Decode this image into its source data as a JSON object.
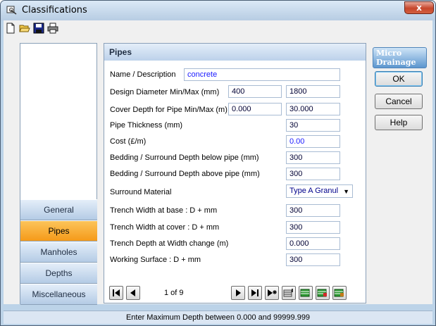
{
  "window": {
    "title": "Classifications",
    "close_label": "x"
  },
  "toolbar": {
    "icons": [
      "new-file-icon",
      "open-folder-icon",
      "save-icon",
      "print-icon"
    ]
  },
  "nav": {
    "items": [
      {
        "label": "General",
        "active": false
      },
      {
        "label": "Pipes",
        "active": true
      },
      {
        "label": "Manholes",
        "active": false
      },
      {
        "label": "Depths",
        "active": false
      },
      {
        "label": "Miscellaneous",
        "active": false
      }
    ]
  },
  "panel": {
    "title": "Pipes",
    "fields": {
      "name": {
        "label": "Name / Description",
        "value": "concrete"
      },
      "diameter": {
        "label": "Design Diameter Min/Max (mm)",
        "min": "400",
        "max": "1800"
      },
      "cover": {
        "label": "Cover Depth for Pipe Min/Max (m)",
        "min": "0.000",
        "max": "30.000"
      },
      "thickness": {
        "label": "Pipe Thickness (mm)",
        "value": "30"
      },
      "cost": {
        "label": "Cost (£/m)",
        "value": "0.00"
      },
      "bedding_below": {
        "label": "Bedding / Surround Depth below pipe (mm)",
        "value": "300"
      },
      "bedding_above": {
        "label": "Bedding / Surround Depth above pipe (mm)",
        "value": "300"
      },
      "surround": {
        "label": "Surround Material",
        "value": "Type A Granul"
      },
      "trench_base": {
        "label": "Trench Width at base : D + mm",
        "value": "300"
      },
      "trench_cover": {
        "label": "Trench Width at cover : D + mm",
        "value": "300"
      },
      "trench_depth": {
        "label": "Trench Depth at Width change (m)",
        "value": "0.000"
      },
      "working_surface": {
        "label": "Working Surface : D + mm",
        "value": "300"
      }
    }
  },
  "record_nav": {
    "position": "1 of 9"
  },
  "logo": {
    "line1": "Micro",
    "line2": "Drainage"
  },
  "buttons": {
    "ok": "OK",
    "cancel": "Cancel",
    "help": "Help"
  },
  "status": {
    "text": "Enter Maximum Depth between 0.000 and 99999.999"
  },
  "colors": {
    "accent": "#f59a19",
    "frame": "#bcd3e8",
    "field_text": "#1a1aff"
  }
}
